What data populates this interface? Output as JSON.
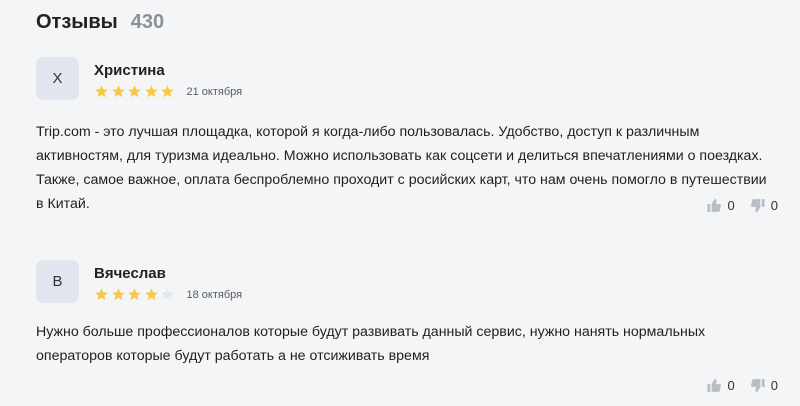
{
  "header": {
    "title": "Отзывы",
    "count": "430"
  },
  "colors": {
    "star_filled": "#f7c948",
    "star_empty": "#e3e6ed",
    "thumb": "#b9bdc6"
  },
  "reviews": [
    {
      "avatar_letter": "Х",
      "author": "Христина",
      "rating": 5,
      "date": "21 октября",
      "text": "Trip.com - это лучшая площадка, которой я когда-либо пользовалась. Удобство, доступ к различным активностям, для туризма идеально. Можно использовать как соцсети и делиться впечатлениями о поездках. Также, самое важное, оплата беспроблемно проходит с росийских карт, что нам очень помогло в путешествии в Китай.",
      "likes": "0",
      "dislikes": "0"
    },
    {
      "avatar_letter": "В",
      "author": "Вячеслав",
      "rating": 4,
      "date": "18 октября",
      "text": "Нужно больше профессионалов которые будут развивать данный сервис, нужно нанять нормальных операторов которые будут работать а не отсиживать время",
      "likes": "0",
      "dislikes": "0"
    }
  ]
}
